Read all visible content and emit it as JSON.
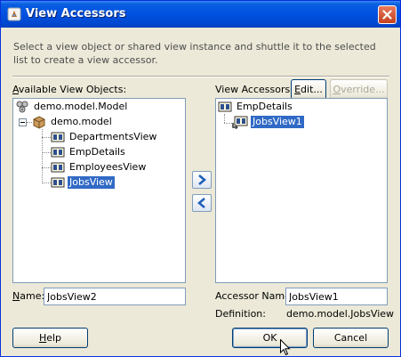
{
  "window": {
    "title": "View Accessors",
    "description": "Select a view object or shared view instance and shuttle it to the selected list to create a view accessor."
  },
  "available": {
    "label_mnemonic": "A",
    "label_rest": "vailable View Objects:",
    "tree": {
      "root": "demo.model.Model",
      "package": "demo.model",
      "items": [
        "DepartmentsView",
        "EmpDetails",
        "EmployeesView",
        "JobsView"
      ],
      "selected": "JobsView"
    },
    "name_label_mnemonic": "N",
    "name_label_rest": "ame:",
    "name_value": "JobsView2"
  },
  "accessors": {
    "label": "View Accessors:",
    "edit_button_mnemonic": "E",
    "edit_button_rest": "dit...",
    "override_button_mnemonic": "O",
    "override_button_rest": "verride...",
    "tree": {
      "root": "EmpDetails",
      "child": "JobsView1"
    },
    "accessor_name_label": "Accessor Name:",
    "accessor_name_value": "JobsView1",
    "definition_label": "Definition:",
    "definition_value": "demo.model.JobsView"
  },
  "buttons": {
    "help_mnemonic": "H",
    "help_rest": "elp",
    "ok": "OK",
    "cancel": "Cancel"
  }
}
